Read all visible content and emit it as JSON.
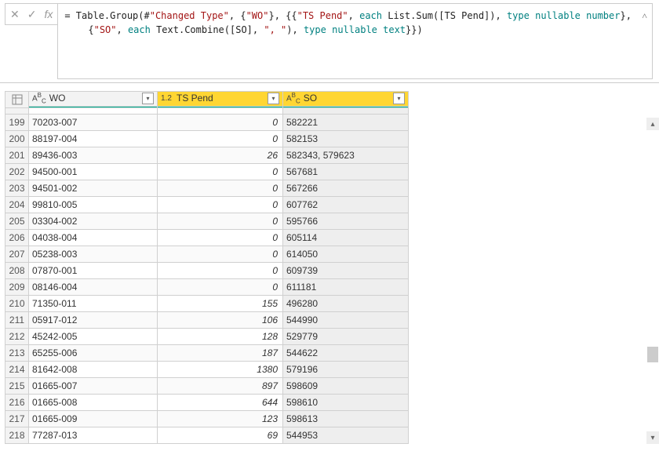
{
  "formula": {
    "prefix": "= Table.Group(#",
    "arg_changed": "\"Changed Type\"",
    "sep1": ", {",
    "arg_wo": "\"WO\"",
    "sep2": "}, {{",
    "arg_tspend": "\"TS Pend\"",
    "sep3": ", ",
    "kw_each1": "each",
    "after_each1": " List.Sum([TS Pend]), ",
    "kw_type1": "type",
    "sp1": " ",
    "kw_null1": "nullable",
    "sp2": " ",
    "kw_num": "number",
    "tail1": "},",
    "line2_open": "{",
    "arg_so": "\"SO\"",
    "sep4": ", ",
    "kw_each2": "each",
    "after_each2": " Text.Combine([SO], ",
    "arg_delim": "\", \"",
    "sep5": "), ",
    "kw_type2": "type",
    "sp3": " ",
    "kw_null2": "nullable",
    "sp4": " ",
    "kw_text": "text",
    "tail2": "}})"
  },
  "columns": {
    "c0_type": "",
    "c1_type_label": "ABC",
    "c1_name": "WO",
    "c2_type_label": "1.2",
    "c2_name": "TS Pend",
    "c3_type_label": "ABC",
    "c3_name": "SO"
  },
  "rows": [
    {
      "n": "199",
      "wo": "70203-007",
      "ts": "0",
      "so": "582221"
    },
    {
      "n": "200",
      "wo": "88197-004",
      "ts": "0",
      "so": "582153"
    },
    {
      "n": "201",
      "wo": "89436-003",
      "ts": "26",
      "so": "582343, 579623"
    },
    {
      "n": "202",
      "wo": "94500-001",
      "ts": "0",
      "so": "567681"
    },
    {
      "n": "203",
      "wo": "94501-002",
      "ts": "0",
      "so": "567266"
    },
    {
      "n": "204",
      "wo": "99810-005",
      "ts": "0",
      "so": "607762"
    },
    {
      "n": "205",
      "wo": "03304-002",
      "ts": "0",
      "so": "595766"
    },
    {
      "n": "206",
      "wo": "04038-004",
      "ts": "0",
      "so": "605114"
    },
    {
      "n": "207",
      "wo": "05238-003",
      "ts": "0",
      "so": "614050"
    },
    {
      "n": "208",
      "wo": "07870-001",
      "ts": "0",
      "so": "609739"
    },
    {
      "n": "209",
      "wo": "08146-004",
      "ts": "0",
      "so": "611181"
    },
    {
      "n": "210",
      "wo": "71350-011",
      "ts": "155",
      "so": "496280"
    },
    {
      "n": "211",
      "wo": "05917-012",
      "ts": "106",
      "so": "544990"
    },
    {
      "n": "212",
      "wo": "45242-005",
      "ts": "128",
      "so": "529779"
    },
    {
      "n": "213",
      "wo": "65255-006",
      "ts": "187",
      "so": "544622"
    },
    {
      "n": "214",
      "wo": "81642-008",
      "ts": "1380",
      "so": "579196"
    },
    {
      "n": "215",
      "wo": "01665-007",
      "ts": "897",
      "so": "598609"
    },
    {
      "n": "216",
      "wo": "01665-008",
      "ts": "644",
      "so": "598610"
    },
    {
      "n": "217",
      "wo": "01665-009",
      "ts": "123",
      "so": "598613"
    },
    {
      "n": "218",
      "wo": "77287-013",
      "ts": "69",
      "so": "544953"
    }
  ]
}
